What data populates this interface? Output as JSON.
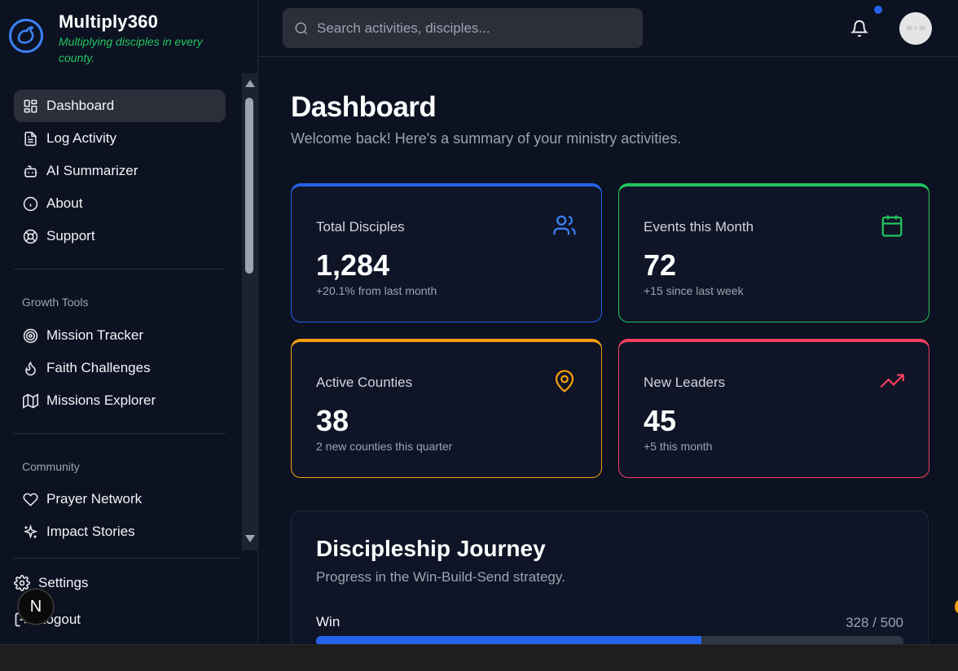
{
  "brand": {
    "title": "Multiply360",
    "tagline": "Multiplying disciples in every county."
  },
  "nav": {
    "primary": [
      {
        "label": "Dashboard",
        "icon": "grid-icon",
        "active": true
      },
      {
        "label": "Log Activity",
        "icon": "file-text-icon"
      },
      {
        "label": "AI Summarizer",
        "icon": "bot-icon"
      },
      {
        "label": "About",
        "icon": "info-icon"
      },
      {
        "label": "Support",
        "icon": "lifebuoy-icon"
      }
    ],
    "growth_label": "Growth Tools",
    "growth": [
      {
        "label": "Mission Tracker",
        "icon": "target-icon"
      },
      {
        "label": "Faith Challenges",
        "icon": "flame-icon"
      },
      {
        "label": "Missions Explorer",
        "icon": "map-icon"
      }
    ],
    "community_label": "Community",
    "community": [
      {
        "label": "Prayer Network",
        "icon": "heart-icon"
      },
      {
        "label": "Impact Stories",
        "icon": "sparkles-icon"
      }
    ],
    "settings_label": "Settings",
    "logout_label": "Logout"
  },
  "dev_badge": "N",
  "search": {
    "placeholder": "Search activities, disciples..."
  },
  "avatar_text": "36 × 36",
  "page": {
    "title": "Dashboard",
    "subtitle": "Welcome back! Here's a summary of your ministry activities."
  },
  "stats": [
    {
      "label": "Total Disciples",
      "value": "1,284",
      "sub": "+20.1% from last month",
      "color": "#2563eb",
      "icon": "users-icon"
    },
    {
      "label": "Events this Month",
      "value": "72",
      "sub": "+15 since last week",
      "color": "#22c55e",
      "icon": "calendar-icon"
    },
    {
      "label": "Active Counties",
      "value": "38",
      "sub": "2 new counties this quarter",
      "color": "#f59e0b",
      "icon": "map-pin-icon"
    },
    {
      "label": "New Leaders",
      "value": "45",
      "sub": "+5 this month",
      "color": "#f43f5e",
      "icon": "trending-up-icon"
    }
  ],
  "journey": {
    "title": "Discipleship Journey",
    "subtitle": "Progress in the Win-Build-Send strategy.",
    "items": [
      {
        "label": "Win",
        "count": "328 / 500",
        "progress": 0.656
      }
    ]
  }
}
